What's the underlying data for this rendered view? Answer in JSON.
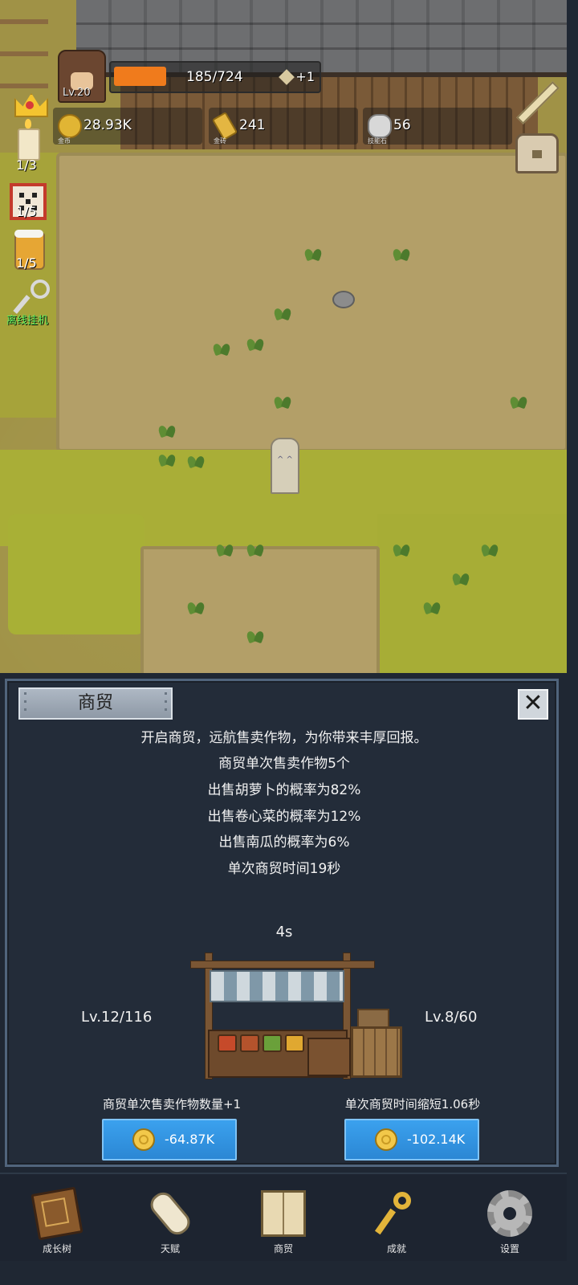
{
  "hud": {
    "level": "Lv.20",
    "xp_text": "185/724",
    "xp_fraction": 0.255,
    "xp_bonus": "+1",
    "resources": [
      {
        "value": "28.93K",
        "caption": "金币"
      },
      {
        "value": "241",
        "caption": "金砖"
      },
      {
        "value": "56",
        "caption": "技能石"
      }
    ],
    "side": {
      "candle_count": "1/3",
      "dice_count": "1/5",
      "beer_count": "1/5",
      "idle_label": "离线挂机"
    },
    "sign_face": "^ ^"
  },
  "panel": {
    "title": "商贸",
    "close_symbol": "✕",
    "description": [
      "开启商贸，远航售卖作物，为你带来丰厚回报。",
      "商贸单次售卖作物5个",
      "出售胡萝卜的概率为82%",
      "出售卷心菜的概率为12%",
      "出售南瓜的概率为6%",
      "单次商贸时间19秒"
    ],
    "timer": "4s",
    "left_upgrade": {
      "level": "Lv.12/116",
      "label": "商贸单次售卖作物数量+1",
      "cost": "-64.87K"
    },
    "right_upgrade": {
      "level": "Lv.8/60",
      "label": "单次商贸时间缩短1.06秒",
      "cost": "-102.14K"
    }
  },
  "nav": {
    "items": [
      {
        "label": "成长树",
        "icon": "book-icon"
      },
      {
        "label": "天赋",
        "icon": "scroll-icon"
      },
      {
        "label": "商贸",
        "icon": "map-icon"
      },
      {
        "label": "成就",
        "icon": "key-icon"
      },
      {
        "label": "设置",
        "icon": "gear-icon"
      }
    ]
  },
  "colors": {
    "xp_fill": "#f07b1c",
    "panel_bg": "#232c39",
    "button_blue": "#2b87d4",
    "idle_green": "#5ff05f"
  }
}
